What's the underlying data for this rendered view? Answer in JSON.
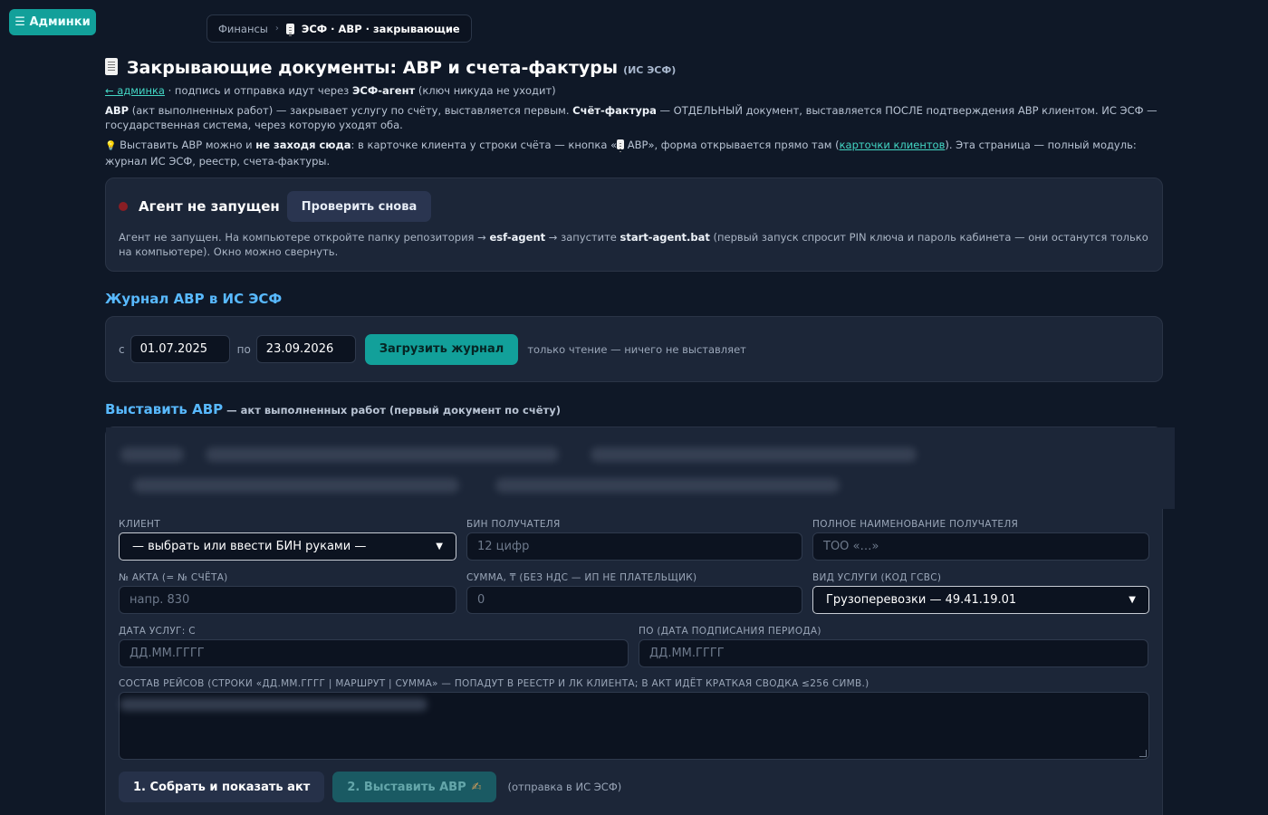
{
  "topbar": {
    "admin_label": "☰ Админки",
    "breadcrumb": {
      "parent": "Финансы",
      "separator": "›",
      "current": "ЭСФ · АВР · закрывающие"
    }
  },
  "header": {
    "title": "Закрывающие документы: АВР и счета-фактуры",
    "subtitle": "(ИС ЭСФ)",
    "back_link": "← админка",
    "back_note_1": " · подпись и отправка идут через ",
    "back_note_agent": "ЭСФ-агент",
    "back_note_2": " (ключ никуда не уходит)",
    "desc_avr": "АВР",
    "desc_1": " (акт выполненных работ) — закрывает услугу по счёту, выставляется первым. ",
    "desc_sf": "Счёт-фактура",
    "desc_2": " — ОТДЕЛЬНЫЙ документ, выставляется ПОСЛЕ подтверждения АВР клиентом. ИС ЭСФ — государственная система, через которую уходят оба.",
    "tip_icon": "💡",
    "tip_1": " Выставить АВР можно и ",
    "tip_bold": "не заходя сюда",
    "tip_2": ": в карточке клиента у строки счёта — кнопка «",
    "tip_3": " АВР», форма открывается прямо там (",
    "tip_link": "карточки клиентов",
    "tip_4": "). Эта страница — полный модуль: журнал ИС ЭСФ, реестр, счета-фактуры."
  },
  "agent": {
    "status": "Агент не запущен",
    "status_color": "#8a1e24",
    "retry_label": "Проверить снова",
    "note_1": "Агент не запущен. На компьютере откройте папку репозитория → ",
    "note_dir": "esf-agent",
    "note_2": " → запустите ",
    "note_file": "start-agent.bat",
    "note_3": " (первый запуск спросит PIN ключа и пароль кабинета — они останутся только на компьютере). Окно можно свернуть."
  },
  "journal": {
    "heading": "Журнал АВР в ИС ЭСФ",
    "from_label": "с",
    "from_value": "01.07.2025",
    "to_label": "по",
    "to_value": "23.09.2026",
    "load_label": "Загрузить журнал",
    "hint": "только чтение — ничего не выставляет"
  },
  "avr": {
    "heading": "Выставить АВР",
    "heading_note": " — акт выполненных работ (первый документ по счёту)",
    "client": {
      "label": "Клиент",
      "selected": "— выбрать или ввести БИН руками —"
    },
    "bin": {
      "label": "БИН получателя",
      "placeholder": "12 цифр"
    },
    "fullname": {
      "label": "Полное наименование получателя",
      "placeholder": "ТОО «…»"
    },
    "act_no": {
      "label": "№ акта (= № счёта)",
      "placeholder": "напр. 830"
    },
    "sum": {
      "label": "Сумма, ₸ (без НДС — ИП не плательщик)",
      "value": "0"
    },
    "service": {
      "label": "Вид услуги (код ГСВС)",
      "selected": "Грузоперевозки — 49.41.19.01"
    },
    "date_from": {
      "label": "Дата услуг: с",
      "placeholder": "ДД.ММ.ГГГГ"
    },
    "date_to": {
      "label": "по (дата подписания периода)",
      "placeholder": "ДД.ММ.ГГГГ"
    },
    "trips": {
      "label": "Состав рейсов (строки «ДД.ММ.ГГГГ | маршрут | сумма» — попадут в реестр и ЛК клиента; в акт идёт краткая сводка ≤256 симв.)"
    },
    "build_label": "1. Собрать и показать акт",
    "send_label": "2. Выставить АВР",
    "send_icon": "✍",
    "send_note": "(отправка в ИС ЭСФ)"
  },
  "colors": {
    "accent": "#12a09a",
    "heading": "#58b9ff",
    "link": "#43d6c4",
    "bg": "#0f1827",
    "card": "#1c2638"
  }
}
